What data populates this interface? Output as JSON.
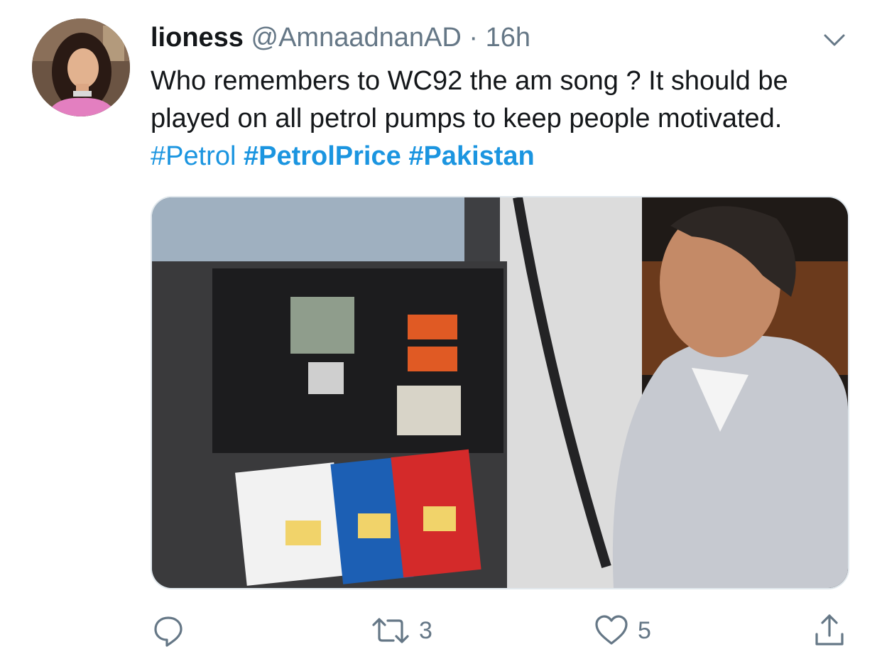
{
  "tweet": {
    "author_name": "lioness",
    "handle": "@AmnaadnanAD",
    "separator": "·",
    "time": "16h",
    "text_main": "Who remembers to WC92 the am song ? It should be played on all petrol pumps to keep people motivated.",
    "hashtags": [
      "#Petrol",
      "#PetrolPrice",
      "#Pakistan"
    ]
  },
  "actions": {
    "reply_icon": "reply-icon",
    "retweet_icon": "retweet-icon",
    "retweet_count": "3",
    "like_icon": "heart-icon",
    "like_count": "5",
    "share_icon": "share-icon"
  },
  "colors": {
    "link": "#1b95e0",
    "secondary_text": "#657786",
    "primary_text": "#14171a"
  }
}
